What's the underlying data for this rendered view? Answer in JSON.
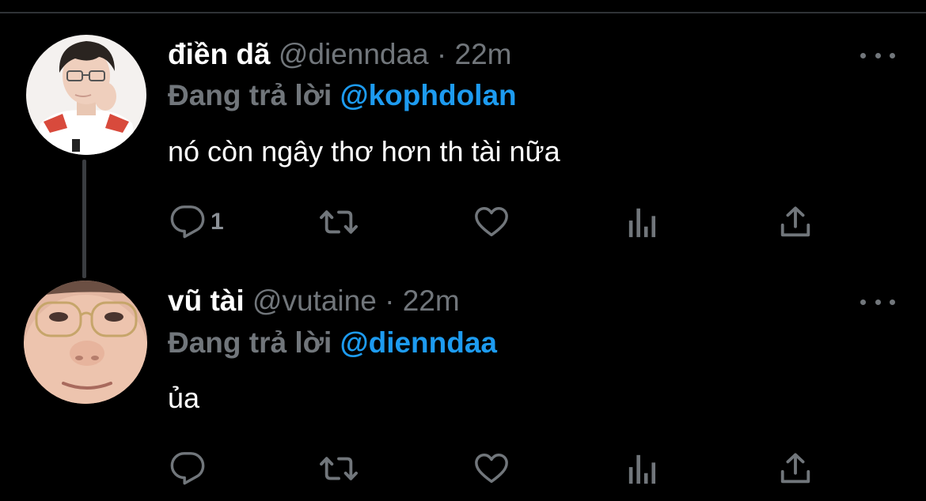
{
  "tweets": [
    {
      "display_name": "điền dã",
      "handle": "@dienndaa",
      "separator": "·",
      "time": "22m",
      "reply_label": "Đang trả lời",
      "reply_to": "@kophdolan",
      "text": "nó còn ngây thơ hơn th tài nữa",
      "reply_count": "1",
      "avatar_icon": "profile-photo"
    },
    {
      "display_name": "vũ tài",
      "handle": "@vutaine",
      "separator": "·",
      "time": "22m",
      "reply_label": "Đang trả lời",
      "reply_to": "@dienndaa",
      "text": "ủa",
      "reply_count": "",
      "avatar_icon": "profile-photo"
    }
  ],
  "actions": {
    "icons": [
      "reply-icon",
      "retweet-icon",
      "like-icon",
      "analytics-icon",
      "share-icon"
    ]
  },
  "colors": {
    "background": "#000000",
    "primary_text": "#ffffff",
    "secondary_text": "#71767b",
    "accent": "#1d9bf0",
    "icon": "#71767b"
  }
}
